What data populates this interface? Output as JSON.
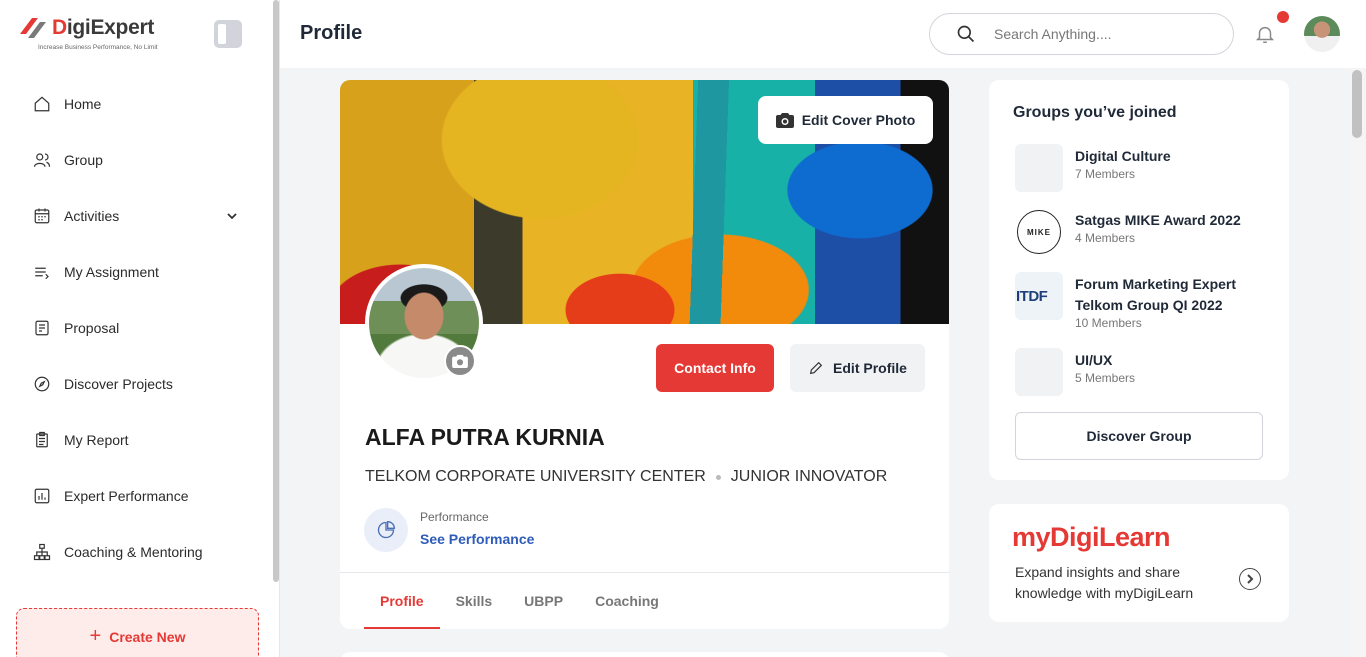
{
  "brand": {
    "name_prefix": "D",
    "name_rest": "igiExpert",
    "tagline": "Increase Business Performance, No Limit",
    "accent": "#e53935"
  },
  "sidebar": {
    "items": [
      {
        "label": "Home",
        "icon": "home-icon"
      },
      {
        "label": "Group",
        "icon": "group-icon"
      },
      {
        "label": "Activities",
        "icon": "calendar-icon",
        "expandable": true
      },
      {
        "label": "My Assignment",
        "icon": "assignment-icon"
      },
      {
        "label": "Proposal",
        "icon": "proposal-icon"
      },
      {
        "label": "Discover Projects",
        "icon": "compass-icon"
      },
      {
        "label": "My Report",
        "icon": "report-icon"
      },
      {
        "label": "Expert Performance",
        "icon": "chart-icon"
      },
      {
        "label": "Coaching & Mentoring",
        "icon": "hierarchy-icon"
      }
    ],
    "create_new": "Create New"
  },
  "header": {
    "title": "Profile",
    "search_placeholder": "Search Anything...."
  },
  "profile": {
    "edit_cover": "Edit Cover Photo",
    "contact_info": "Contact Info",
    "edit_profile": "Edit Profile",
    "name": "ALFA PUTRA KURNIA",
    "organization": "TELKOM CORPORATE UNIVERSITY CENTER",
    "role": "JUNIOR INNOVATOR",
    "performance_label": "Performance",
    "performance_link": "See Performance",
    "tabs": [
      "Profile",
      "Skills",
      "UBPP",
      "Coaching"
    ],
    "active_tab": "Profile"
  },
  "groups": {
    "title": "Groups you’ve joined",
    "items": [
      {
        "name": "Digital Culture",
        "members": "7 Members"
      },
      {
        "name": "Satgas MIKE Award 2022",
        "members": "4 Members"
      },
      {
        "name": "Forum Marketing Expert Telkom Group QI 2022",
        "members": "10 Members"
      },
      {
        "name": "UI/UX",
        "members": "5 Members"
      }
    ],
    "discover": "Discover Group"
  },
  "learn": {
    "logo": "myDigiLearn",
    "description": "Expand insights and share knowledge with myDigiLearn"
  }
}
